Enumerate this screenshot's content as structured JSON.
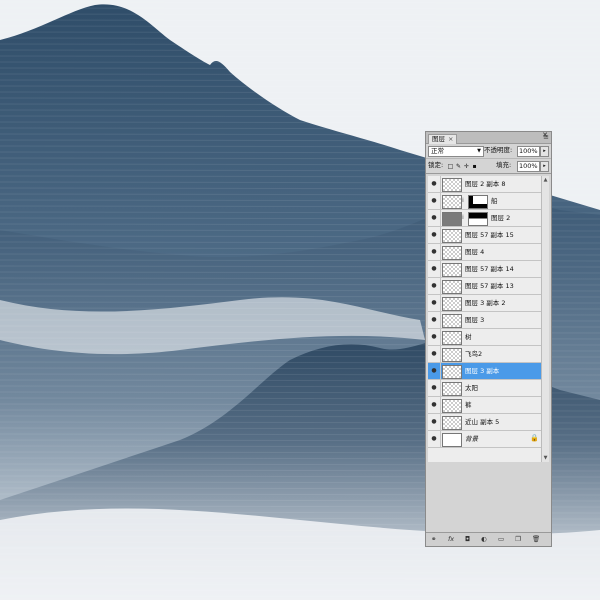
{
  "colors": {
    "ink_dark": "#2c4a66",
    "ink_mid": "#5d7993",
    "mist": "#eef1f4",
    "panel_bg": "#d4d4d4",
    "selection": "#4a9ae8"
  },
  "panel": {
    "tab_label": "图层",
    "tab_close": "×",
    "menu_icon": "menu-icon",
    "blend_mode": "正常",
    "opacity_label": "不透明度:",
    "opacity_value": "100%",
    "lock_label": "锁定:",
    "fill_label": "填充:",
    "fill_value": "100%",
    "layers": [
      {
        "name": "图层 2 副本 8",
        "selected": false
      },
      {
        "name": "船",
        "selected": false
      },
      {
        "name": "图层 2",
        "selected": false
      },
      {
        "name": "图层 57 副本 15",
        "selected": false
      },
      {
        "name": "图层 4",
        "selected": false
      },
      {
        "name": "图层 57 副本 14",
        "selected": false
      },
      {
        "name": "图层 57 副本 13",
        "selected": false
      },
      {
        "name": "图层 3 副本 2",
        "selected": false
      },
      {
        "name": "图层 3",
        "selected": false
      },
      {
        "name": "树",
        "selected": false
      },
      {
        "name": "飞鸟2",
        "selected": false
      },
      {
        "name": "图层 3 副本",
        "selected": true
      },
      {
        "name": "太阳",
        "selected": false
      },
      {
        "name": "裤",
        "selected": false
      },
      {
        "name": "近山 副本 5",
        "selected": false
      },
      {
        "name": "背景",
        "selected": false
      }
    ]
  }
}
